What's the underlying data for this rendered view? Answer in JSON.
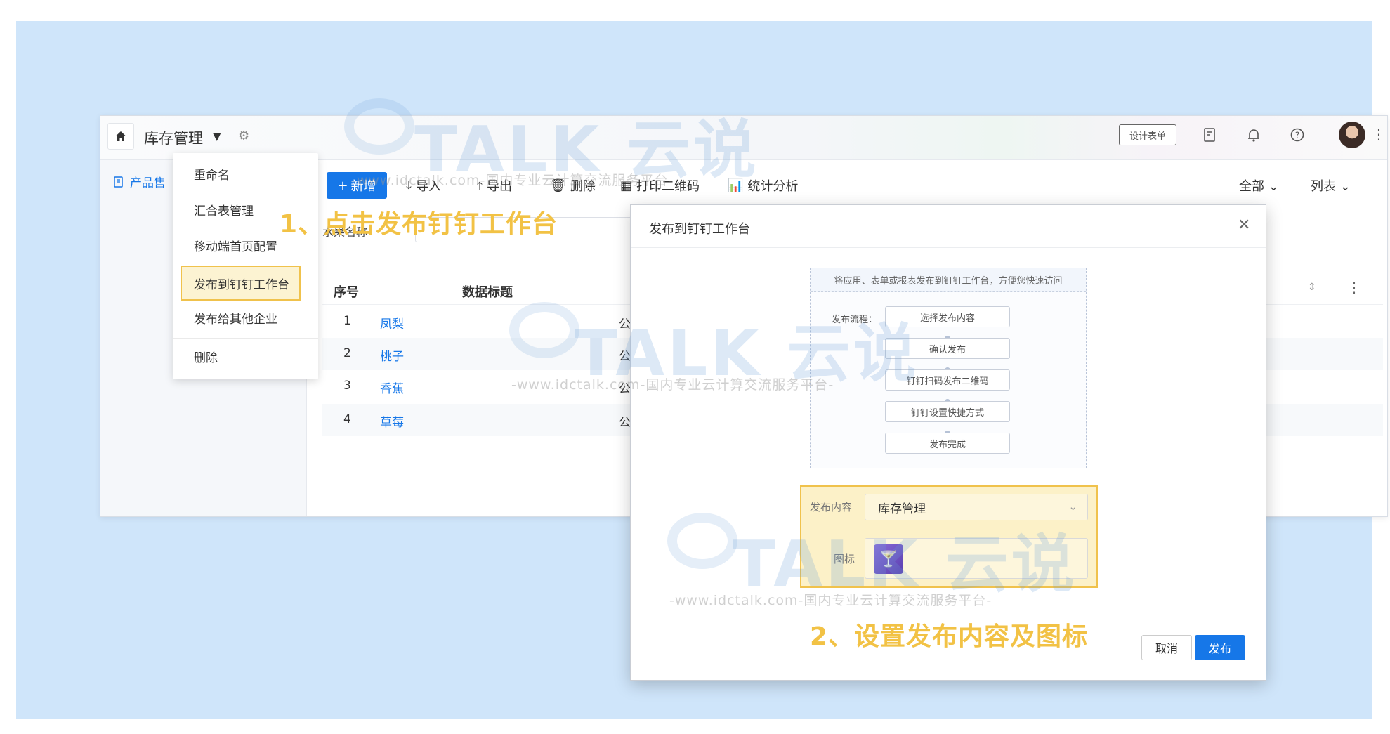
{
  "header": {
    "app_title": "库存管理",
    "design_form_label": "设计表单"
  },
  "icons": {
    "home": "home-icon",
    "settings": "gear-icon",
    "form": "form-icon",
    "bell": "bell-icon",
    "help": "help-icon",
    "more": "more-icon"
  },
  "sidebar": {
    "items": [
      {
        "label": "产品售"
      }
    ]
  },
  "toolbar": {
    "add_label": "新增",
    "import_label": "导入",
    "export_label": "导出",
    "delete_label": "删除",
    "qrcode_label": "打印二维码",
    "stats_label": "统计分析",
    "filter_all_label": "全部",
    "view_list_label": "列表"
  },
  "filter": {
    "label": "水果名称"
  },
  "table": {
    "columns": [
      "序号",
      "数据标题"
    ],
    "rows": [
      {
        "index": "1",
        "title": "凤梨",
        "extra": "公"
      },
      {
        "index": "2",
        "title": "桃子",
        "extra": "公"
      },
      {
        "index": "3",
        "title": "香蕉",
        "extra": "公"
      },
      {
        "index": "4",
        "title": "草莓",
        "extra": "公"
      }
    ]
  },
  "menu": {
    "items": [
      {
        "label": "重命名"
      },
      {
        "label": "汇合表管理"
      },
      {
        "label": "移动端首页配置"
      },
      {
        "label": "发布到钉钉工作台",
        "highlighted": true
      },
      {
        "label": "发布给其他企业"
      },
      {
        "label": "删除"
      }
    ]
  },
  "annotations": {
    "step1": "1、点击发布钉钉工作台",
    "step2": "2、设置发布内容及图标"
  },
  "watermark": {
    "brand": "TALK 云说",
    "tagline": "-www.idctalk.com-国内专业云计算交流服务平台-"
  },
  "modal": {
    "title": "发布到钉钉工作台",
    "description": "将应用、表单或报表发布到钉钉工作台，方便您快速访问",
    "flow_label": "发布流程：",
    "steps": [
      "选择发布内容",
      "确认发布",
      "钉钉扫码发布二维码",
      "钉钉设置快捷方式",
      "发布完成"
    ],
    "content_label": "发布内容",
    "content_value": "库存管理",
    "icon_label": "图标",
    "cancel_label": "取消",
    "publish_label": "发布"
  },
  "colors": {
    "accent": "#1677e8",
    "highlight": "#f0c24c",
    "annotation": "#f2c245",
    "background": "#cfe5fa"
  }
}
